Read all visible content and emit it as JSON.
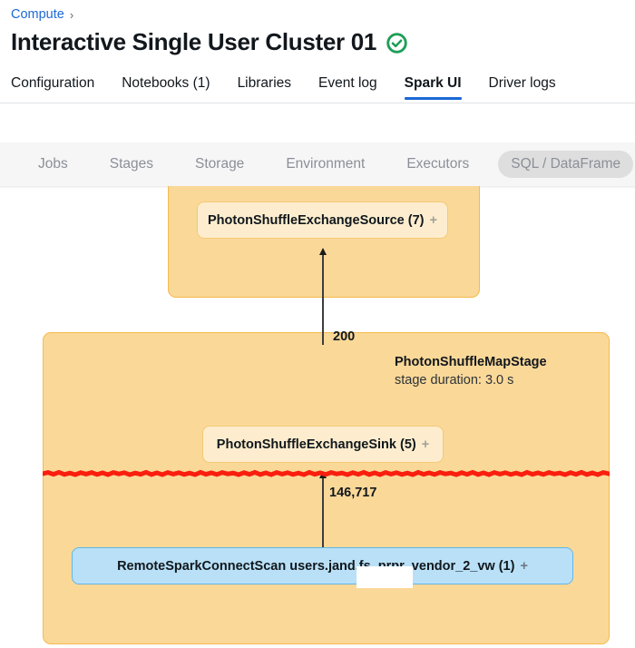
{
  "breadcrumb": {
    "parent": "Compute",
    "separator": "›"
  },
  "header": {
    "title": "Interactive Single User Cluster 01",
    "status_icon": "check-circle-icon",
    "status_color": "#1f9e58"
  },
  "tabs": [
    {
      "label": "Configuration",
      "active": false
    },
    {
      "label": "Notebooks (1)",
      "active": false
    },
    {
      "label": "Libraries",
      "active": false
    },
    {
      "label": "Event log",
      "active": false
    },
    {
      "label": "Spark UI",
      "active": true
    },
    {
      "label": "Driver logs",
      "active": false
    }
  ],
  "tab_accent_color": "#1b69d6",
  "subnav": {
    "items": [
      {
        "label": "Jobs",
        "active": false
      },
      {
        "label": "Stages",
        "active": false
      },
      {
        "label": "Storage",
        "active": false
      },
      {
        "label": "Environment",
        "active": false
      },
      {
        "label": "Executors",
        "active": false
      },
      {
        "label": "SQL / DataFrame",
        "active": true
      }
    ],
    "background": "#f6f6f7",
    "active_pill_color": "#dededf"
  },
  "graph": {
    "stages": [
      {
        "id": "stage-top",
        "title": "",
        "duration": "",
        "color": "#fad898",
        "border_color": "#f5ba4e"
      },
      {
        "id": "stage-bottom",
        "title": "PhotonShuffleMapStage",
        "duration": "stage duration: 3.0 s",
        "color": "#fad898",
        "border_color": "#f5ba4e"
      }
    ],
    "nodes": [
      {
        "id": "node-source",
        "label": "PhotonShuffleExchangeSource (7)",
        "expand": "+",
        "type": "photon"
      },
      {
        "id": "node-sink",
        "label": "PhotonShuffleExchangeSink (5)",
        "expand": "+",
        "type": "photon"
      },
      {
        "id": "node-scan",
        "label_before": "RemoteSparkConnectScan users.ja",
        "label_after": "nd.fs_prpr_vendor_2_vw (1)",
        "expand": "+",
        "type": "scan",
        "redacted": true
      }
    ],
    "edges": [
      {
        "from": "node-sink",
        "to": "node-source",
        "label": "200"
      },
      {
        "from": "node-scan",
        "to": "node-sink",
        "label": "146,717"
      }
    ],
    "annotation": {
      "type": "red-squiggle-line",
      "color": "#fa1e0e"
    }
  }
}
